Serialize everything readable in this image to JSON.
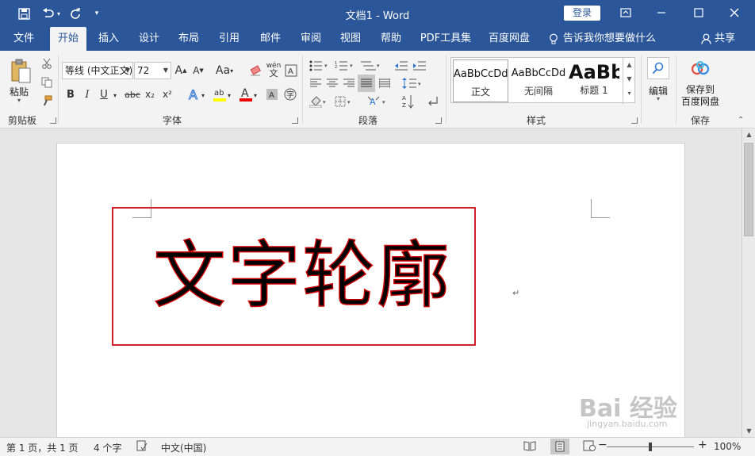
{
  "app": {
    "title": "文档1 - Word",
    "login_label": "登录",
    "window_buttons": [
      "ribbon-display",
      "minimize",
      "maximize",
      "close"
    ]
  },
  "quick_access": [
    "save-icon",
    "undo-icon",
    "redo-icon",
    "customize-icon"
  ],
  "menu": {
    "tabs": [
      "文件",
      "开始",
      "插入",
      "设计",
      "布局",
      "引用",
      "邮件",
      "审阅",
      "视图",
      "帮助",
      "PDF工具集",
      "百度网盘"
    ],
    "active_tab": "开始",
    "tell_me": "告诉我你想要做什么",
    "share": "共享"
  },
  "ribbon": {
    "clipboard": {
      "label": "剪贴板",
      "paste_label": "粘贴"
    },
    "font": {
      "label": "字体",
      "font_name": "等线 (中文正文)",
      "font_size": "72",
      "case_label": "Aa",
      "buttons": [
        "B",
        "I",
        "U",
        "abc",
        "x₂",
        "x²"
      ],
      "phonetic_label": "wén"
    },
    "paragraph": {
      "label": "段落"
    },
    "styles": {
      "label": "样式",
      "items": [
        {
          "preview": "AaBbCcDd",
          "name": "正文"
        },
        {
          "preview": "AaBbCcDd",
          "name": "无间隔"
        },
        {
          "preview": "AaBb",
          "name": "标题 1"
        }
      ]
    },
    "editing": {
      "label": "编辑"
    },
    "save": {
      "label": "保存",
      "button_label": "保存到\n百度网盘",
      "line1": "保存到",
      "line2": "百度网盘"
    }
  },
  "document": {
    "text": "文字轮廓",
    "outline_color": "#cc0000",
    "box_color": "#d0202a"
  },
  "status": {
    "page": "第 1 页，共 1 页",
    "words": "4 个字",
    "language": "中文(中国)",
    "zoom": "100%",
    "zoom_minus": "−",
    "zoom_plus": "+",
    "zoom_level": 100
  },
  "watermark": {
    "text": "Bai 经验",
    "sub": "jingyan.baidu.com"
  },
  "colors": {
    "brand": "#2b579a",
    "ribbon": "#f3f3f3"
  }
}
